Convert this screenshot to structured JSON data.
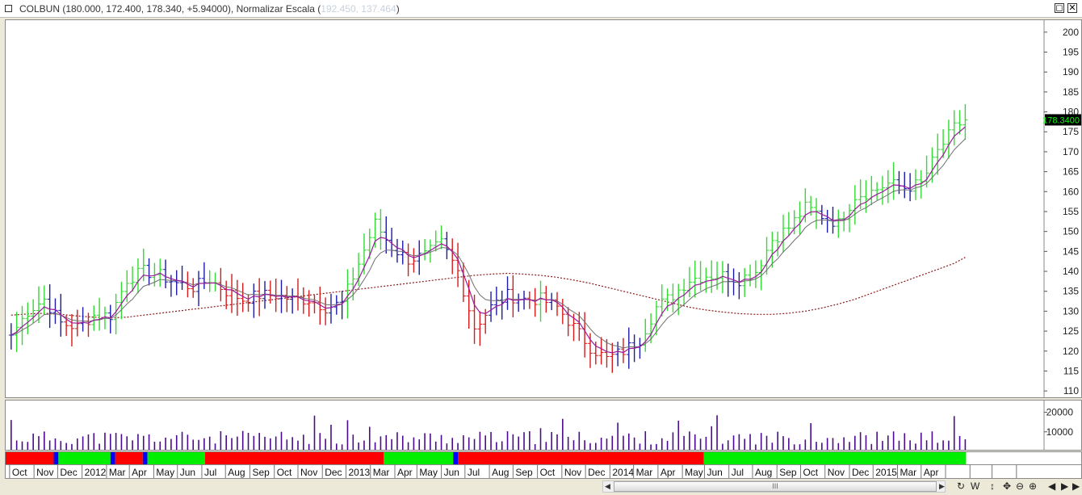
{
  "title": {
    "symbol": "COLBUN",
    "values": "(180.000, 172.400, 178.340, +5.94000),",
    "scale_label": "Normalizar Escala",
    "scale_open": "(",
    "scale_values": "192.450, 137.464",
    "scale_close": ")"
  },
  "window_controls": {
    "restore": "◻",
    "close": "✕"
  },
  "price_axis": {
    "ticks": [
      "200",
      "195",
      "190",
      "185",
      "180",
      "175",
      "170",
      "165",
      "160",
      "155",
      "150",
      "145",
      "140",
      "135",
      "130",
      "125",
      "120",
      "115",
      "110"
    ],
    "current_price": "178.3400"
  },
  "volume_axis": {
    "ticks": [
      "20000",
      "10000"
    ]
  },
  "time_axis": {
    "labels": [
      "Oct",
      "Nov",
      "Dec",
      "2012",
      "Mar",
      "Apr",
      "May",
      "Jun",
      "Jul",
      "Aug",
      "Sep",
      "Oct",
      "Nov",
      "Dec",
      "2013",
      "Mar",
      "Apr",
      "May",
      "Jun",
      "Jul",
      "Aug",
      "Sep",
      "Oct",
      "Nov",
      "Dec",
      "2014",
      "Mar",
      "Apr",
      "May",
      "Jun",
      "Jul",
      "Aug",
      "Sep",
      "Oct",
      "Nov",
      "Dec",
      "2015",
      "Mar",
      "Apr"
    ]
  },
  "trend_band": [
    {
      "state": "red"
    },
    {
      "state": "blue"
    },
    {
      "state": "green"
    },
    {
      "state": "blue"
    },
    {
      "state": "red"
    },
    {
      "state": "blue"
    },
    {
      "state": "green"
    },
    {
      "state": "red"
    },
    {
      "state": "green"
    },
    {
      "state": "blue"
    },
    {
      "state": "red"
    },
    {
      "state": "green"
    }
  ],
  "colors": {
    "bull": "#35d935",
    "bear": "#d71a1a",
    "neutral": "#1b1ba8",
    "ma_fast": "#9c1a9c",
    "ma_slow": "#707070",
    "ma_long": "#8b1a1a",
    "volume": "#4b0b8c",
    "band_red": "#ff0000",
    "band_green": "#00ee00",
    "band_blue": "#0000ff",
    "price_badge_bg": "#000000",
    "price_badge_fg": "#00ff00"
  },
  "chart_data": {
    "type": "line",
    "description_kind": "weekly price chart with moving averages and volume",
    "x": [
      "2011-10-03",
      "2011-10-24",
      "2011-11-14",
      "2011-12-05",
      "2011-12-26",
      "2012-01-16",
      "2012-02-06",
      "2012-02-27",
      "2012-03-19",
      "2012-04-09",
      "2012-04-30",
      "2012-05-21",
      "2012-06-11",
      "2012-07-02",
      "2012-07-23",
      "2012-08-13",
      "2012-09-03",
      "2012-09-24",
      "2012-10-15",
      "2012-11-05",
      "2012-11-26",
      "2012-12-17",
      "2013-01-07",
      "2013-01-28",
      "2013-02-18",
      "2013-03-11",
      "2013-04-01",
      "2013-04-22",
      "2013-05-13",
      "2013-06-03",
      "2013-06-24",
      "2013-07-15",
      "2013-08-05",
      "2013-08-26",
      "2013-09-16",
      "2013-10-07",
      "2013-10-28",
      "2013-11-18",
      "2013-12-09",
      "2013-12-30",
      "2014-01-20",
      "2014-02-10",
      "2014-03-03",
      "2014-03-24",
      "2014-04-14",
      "2014-05-05",
      "2014-05-26",
      "2014-06-16",
      "2014-07-07",
      "2014-07-28",
      "2014-08-18",
      "2014-09-08",
      "2014-09-29",
      "2014-10-20",
      "2014-11-10",
      "2014-12-01",
      "2014-12-22",
      "2015-01-12",
      "2015-01-26"
    ],
    "series": [
      {
        "kind": "close",
        "values": [
          124,
          130,
          133,
          127,
          126,
          129,
          129,
          138,
          140,
          139,
          137,
          136,
          138,
          135,
          133,
          134,
          134,
          133,
          133,
          131,
          132,
          142,
          152,
          146,
          143,
          144,
          147,
          140,
          126,
          131,
          134,
          133,
          133,
          131,
          126,
          121,
          118,
          120,
          123,
          131,
          134,
          138,
          139,
          139,
          138,
          140,
          148,
          151,
          156,
          154,
          152,
          159,
          160,
          162,
          161,
          162,
          170,
          176,
          178
        ]
      },
      {
        "kind": "ma_long",
        "values": [
          129,
          129.3,
          129.5,
          129.2,
          128.8,
          128.5,
          128.3,
          128.5,
          129,
          129.5,
          130,
          130.5,
          131,
          131.5,
          132,
          132.5,
          133,
          133.5,
          134,
          134.5,
          135,
          135.5,
          136,
          136.5,
          137,
          137.5,
          138,
          138.5,
          139,
          139.3,
          139.5,
          139.3,
          139,
          138.5,
          137.8,
          137,
          136,
          135,
          134,
          133,
          132,
          131,
          130.3,
          129.8,
          129.4,
          129.2,
          129.2,
          129.5,
          130,
          130.8,
          131.8,
          133,
          134.5,
          136,
          137.5,
          139,
          140.5,
          142,
          143.5
        ]
      }
    ],
    "ylim": [
      108,
      203
    ],
    "volume_ticks": [
      20000,
      10000
    ]
  }
}
